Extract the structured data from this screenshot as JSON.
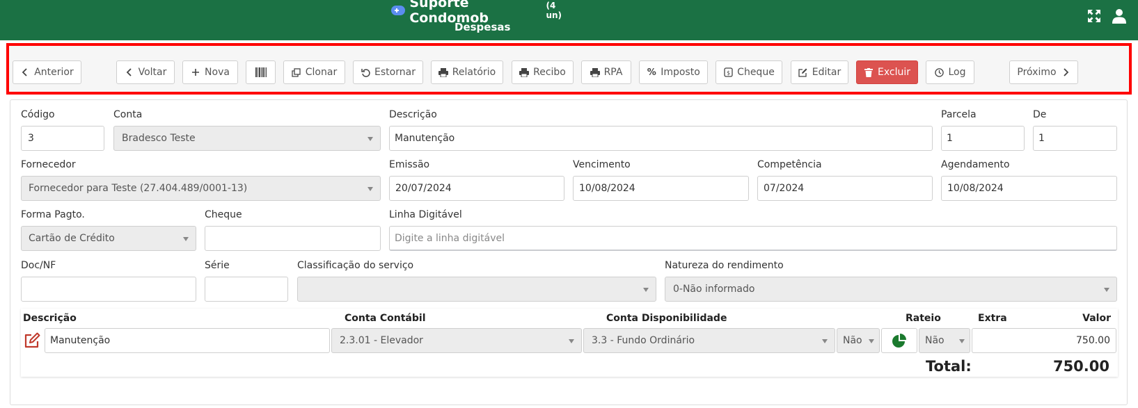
{
  "header": {
    "app_name": "Suporte Condomob",
    "units": "(4 un)",
    "subtitle": "Despesas"
  },
  "toolbar": {
    "prev": "Anterior",
    "back": "Voltar",
    "new": "Nova",
    "clone": "Clonar",
    "reverse": "Estornar",
    "report": "Relatório",
    "receipt": "Recibo",
    "rpa": "RPA",
    "tax": "Imposto",
    "check": "Cheque",
    "edit": "Editar",
    "delete": "Excluir",
    "log": "Log",
    "next": "Próximo"
  },
  "form": {
    "codigo": {
      "label": "Código",
      "value": "3"
    },
    "conta": {
      "label": "Conta",
      "value": "Bradesco Teste"
    },
    "descricao": {
      "label": "Descrição",
      "value": "Manutenção"
    },
    "parcela": {
      "label": "Parcela",
      "value": "1"
    },
    "de": {
      "label": "De",
      "value": "1"
    },
    "fornecedor": {
      "label": "Fornecedor",
      "value": "Fornecedor para Teste (27.404.489/0001-13)"
    },
    "emissao": {
      "label": "Emissão",
      "value": "20/07/2024"
    },
    "vencimento": {
      "label": "Vencimento",
      "value": "10/08/2024"
    },
    "competencia": {
      "label": "Competência",
      "value": "07/2024"
    },
    "agendamento": {
      "label": "Agendamento",
      "value": "10/08/2024"
    },
    "forma_pagto": {
      "label": "Forma Pagto.",
      "value": "Cartão de Crédito"
    },
    "cheque": {
      "label": "Cheque",
      "value": ""
    },
    "linha_digitavel": {
      "label": "Linha Digitável",
      "placeholder": "Digite a linha digitável"
    },
    "doc_nf": {
      "label": "Doc/NF",
      "value": ""
    },
    "serie": {
      "label": "Série",
      "value": ""
    },
    "classificacao": {
      "label": "Classificação do serviço",
      "value": ""
    },
    "natureza": {
      "label": "Natureza do rendimento",
      "value": "0-Não informado"
    }
  },
  "items_table": {
    "headers": {
      "descricao": "Descrição",
      "conta_contabil": "Conta Contábil",
      "conta_disp": "Conta Disponibilidade",
      "rateio": "Rateio",
      "extra": "Extra",
      "valor": "Valor"
    },
    "rows": [
      {
        "descricao": "Manutenção",
        "conta_contabil": "2.3.01 - Elevador",
        "conta_disp": "3.3 - Fundo Ordinário",
        "rateio": "Não",
        "extra": "Não",
        "valor": "750.00"
      }
    ],
    "total_label": "Total:",
    "total_value": "750.00"
  },
  "colors": {
    "header_bg": "#1b7144",
    "danger": "#dc5350",
    "highlight_border": "#ff0000",
    "pie_green": "#1b7a2e"
  }
}
